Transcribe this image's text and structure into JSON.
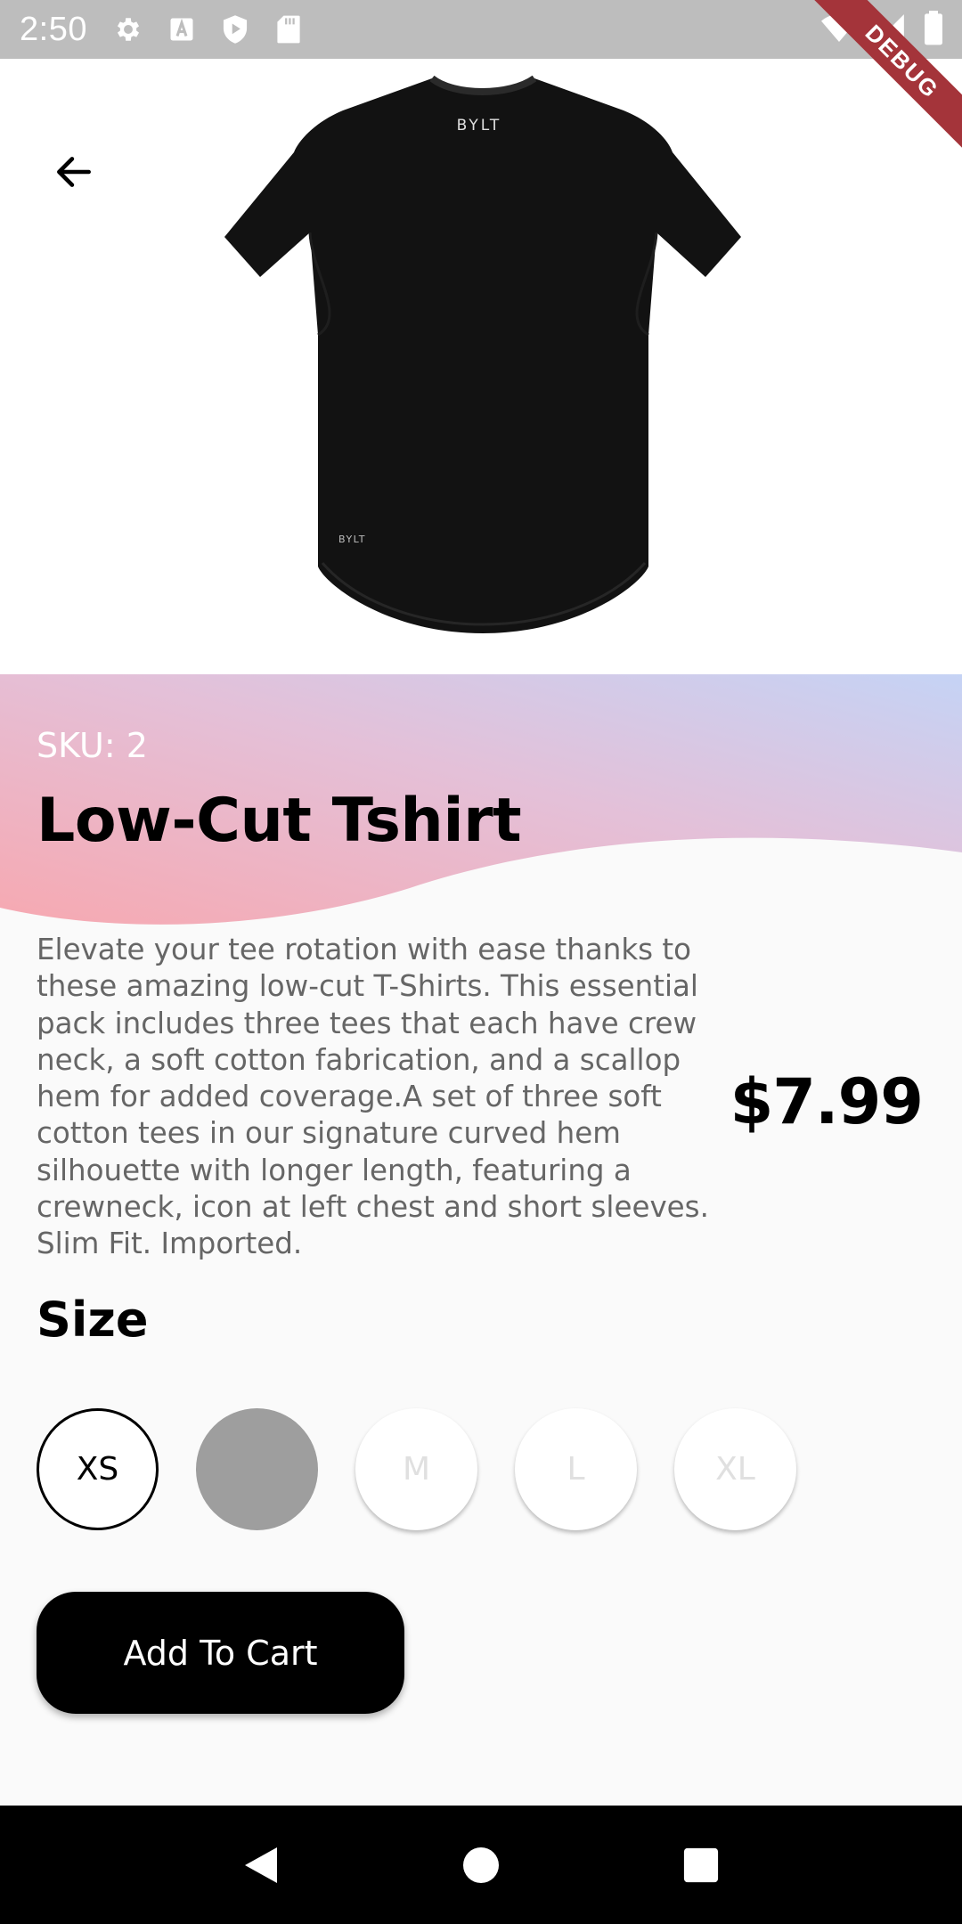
{
  "status_bar": {
    "time": "2:50",
    "icons": [
      "settings-icon",
      "text-a-icon",
      "play-protect-icon",
      "sd-card-icon"
    ],
    "right_icons": [
      "wifi-icon",
      "signal-icon",
      "battery-icon"
    ]
  },
  "debug_label": "DEBUG",
  "product": {
    "sku": "SKU: 2",
    "title": "Low-Cut Tshirt",
    "description": "Elevate your tee rotation with ease thanks to these amazing low-cut T-Shirts. This essential pack includes three tees that each have crew neck, a soft cotton fabrication, and a scallop hem for added coverage.A set of three soft cotton tees in our signature curved hem silhouette with longer length, featuring a crewneck, icon at left chest and short sleeves. Slim Fit. Imported.",
    "price": "$7.99",
    "image_brand": "BYLT",
    "image_hem_brand": "BYLT"
  },
  "size_section": {
    "heading": "Size",
    "options": [
      {
        "label": "XS",
        "state": "selected"
      },
      {
        "label": "",
        "state": "filled"
      },
      {
        "label": "M",
        "state": "disabled"
      },
      {
        "label": "L",
        "state": "disabled"
      },
      {
        "label": "XL",
        "state": "disabled"
      }
    ]
  },
  "add_to_cart_label": "Add To Cart",
  "colors": {
    "banner_gradient_start": "#f7a8b0",
    "banner_gradient_end": "#c5d3f5",
    "button_bg": "#000000",
    "status_bar_bg": "#bdbdbd",
    "debug_ribbon": "#a4343a"
  },
  "nav_bar": [
    "back-icon",
    "home-icon",
    "recents-icon"
  ]
}
